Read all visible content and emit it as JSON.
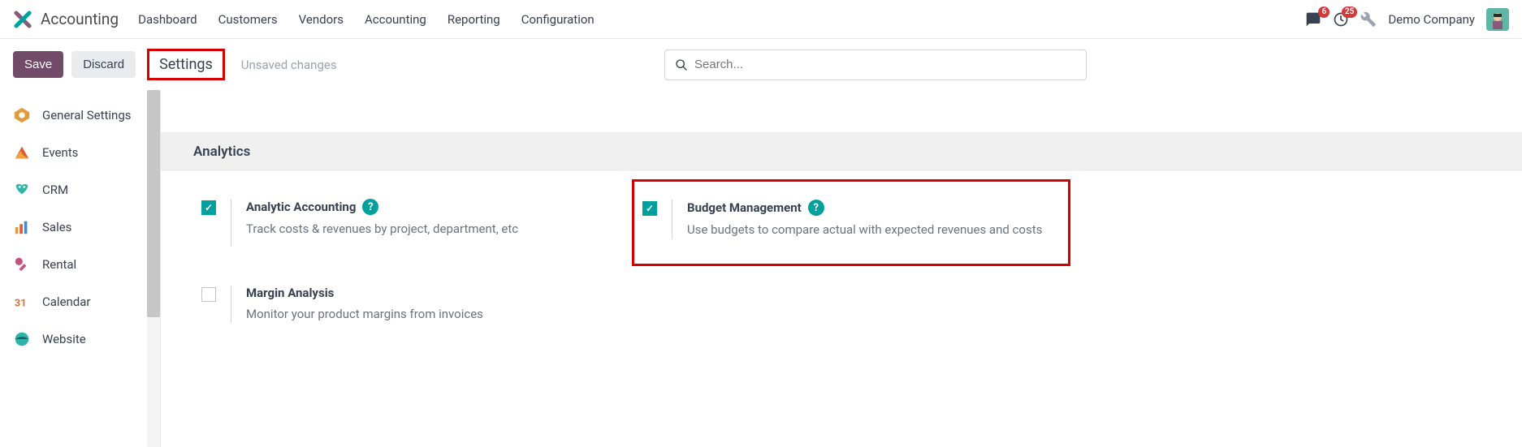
{
  "topnav": {
    "brand": "Accounting",
    "menu": [
      "Dashboard",
      "Customers",
      "Vendors",
      "Accounting",
      "Reporting",
      "Configuration"
    ],
    "messages_badge": "6",
    "activities_badge": "25",
    "company": "Demo Company"
  },
  "actionbar": {
    "save": "Save",
    "discard": "Discard",
    "breadcrumb": "Settings",
    "unsaved": "Unsaved changes",
    "search_placeholder": "Search..."
  },
  "sidebar": {
    "items": [
      {
        "label": "General Settings"
      },
      {
        "label": "Events"
      },
      {
        "label": "CRM"
      },
      {
        "label": "Sales"
      },
      {
        "label": "Rental"
      },
      {
        "label": "Calendar"
      },
      {
        "label": "Website"
      }
    ]
  },
  "section": {
    "title": "Analytics"
  },
  "settings": {
    "analytic": {
      "title": "Analytic Accounting",
      "desc": "Track costs & revenues by project, department, etc"
    },
    "budget": {
      "title": "Budget Management",
      "desc": "Use budgets to compare actual with expected revenues and costs"
    },
    "margin": {
      "title": "Margin Analysis",
      "desc": "Monitor your product margins from invoices"
    }
  }
}
